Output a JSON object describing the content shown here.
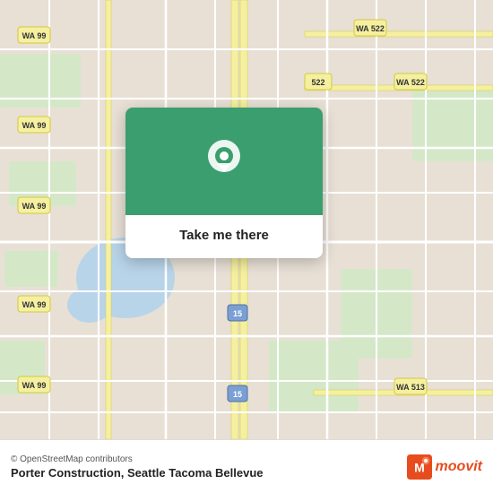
{
  "map": {
    "background_color": "#ede8e0",
    "overlay_bg": "#3a9e6e"
  },
  "card": {
    "button_label": "Take me there"
  },
  "bottom_bar": {
    "osm_credit": "© OpenStreetMap contributors",
    "location_name": "Porter Construction, Seattle Tacoma Bellevue",
    "moovit_label": "moovit"
  }
}
